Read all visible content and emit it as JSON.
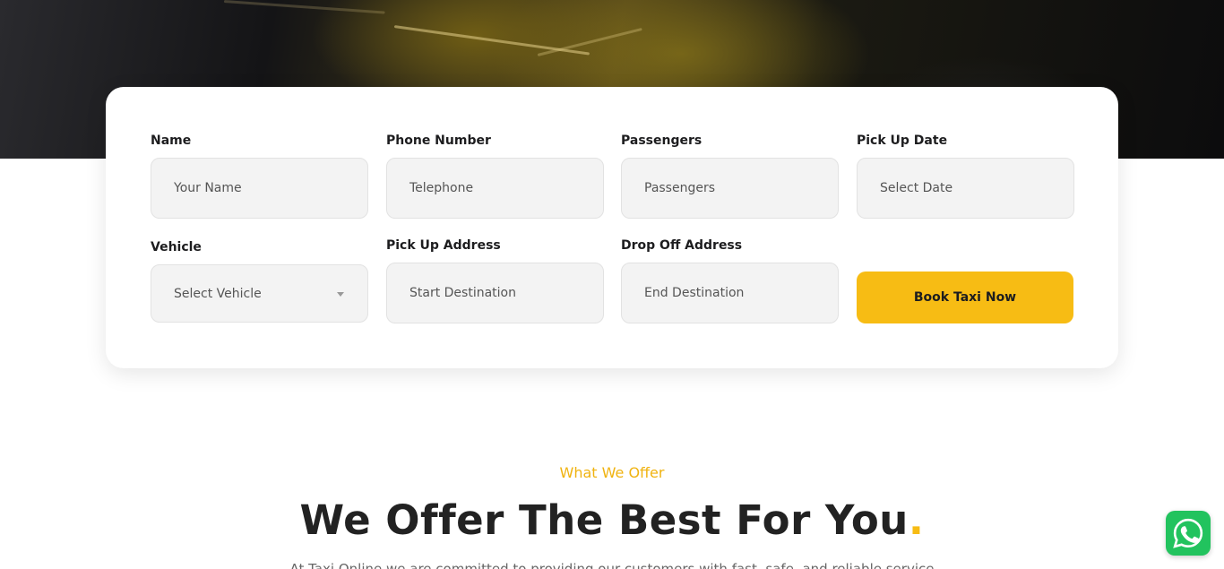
{
  "form": {
    "fields": [
      {
        "label": "Name",
        "placeholder": "Your Name"
      },
      {
        "label": "Phone Number",
        "placeholder": "Telephone"
      },
      {
        "label": "Passengers",
        "placeholder": "Passengers"
      },
      {
        "label": "Pick Up Date",
        "placeholder": "Select Date"
      },
      {
        "label": "Vehicle",
        "placeholder": "Select Vehicle"
      },
      {
        "label": "Pick Up Address",
        "placeholder": "Start Destination"
      },
      {
        "label": "Drop Off Address",
        "placeholder": "End Destination"
      }
    ],
    "submit_label": "Book Taxi Now"
  },
  "offer": {
    "kicker": "What We Offer",
    "headline": "We Offer The Best For You",
    "headline_dot": ".",
    "subtext": "At Taxi Online we are committed to providing our customers with fast, safe, and reliable service"
  },
  "colors": {
    "accent": "#f7bc14",
    "whatsapp": "#22c35e"
  },
  "icons": {
    "select_caret": "caret-down-icon",
    "whatsapp": "whatsapp-icon"
  }
}
